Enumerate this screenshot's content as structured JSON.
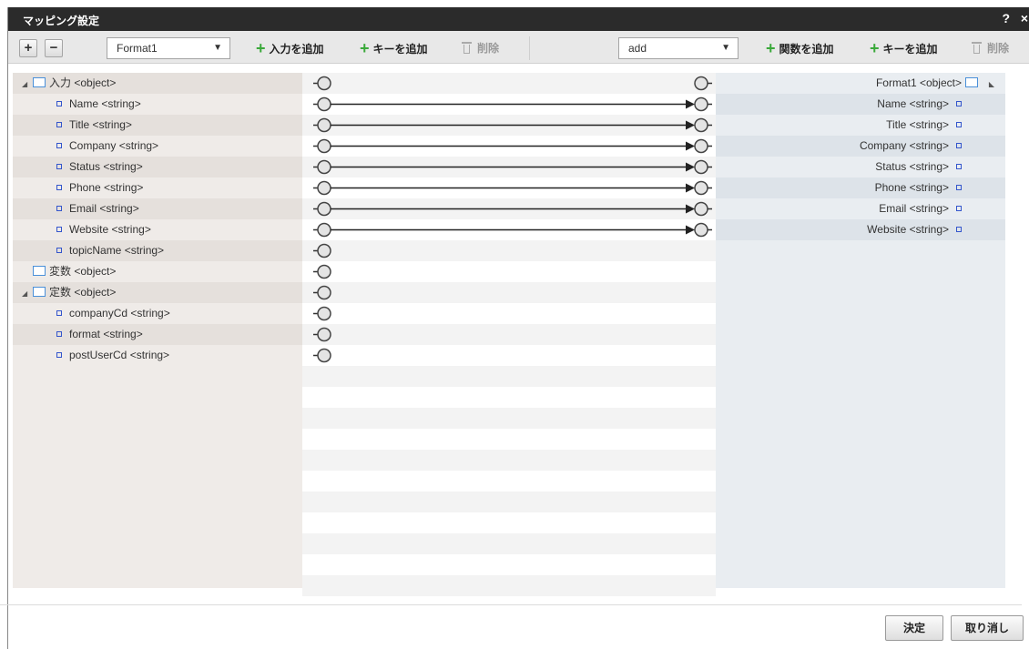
{
  "dialog": {
    "title": "マッピング設定",
    "help": "?",
    "close": "×"
  },
  "toolbar": {
    "expand": "+",
    "collapse": "−",
    "left_select": "Format1",
    "add_input": "入力を追加",
    "add_key_left": "キーを追加",
    "delete_left": "削除",
    "right_select": "add",
    "add_function": "関数を追加",
    "add_key_right": "キーを追加",
    "delete_right": "削除",
    "select_arrow": "▼"
  },
  "left_tree": [
    {
      "label": "入力 <object>",
      "kind": "object",
      "expanded": true,
      "indent": 0
    },
    {
      "label": "Name <string>",
      "kind": "string",
      "indent": 1
    },
    {
      "label": "Title <string>",
      "kind": "string",
      "indent": 1
    },
    {
      "label": "Company <string>",
      "kind": "string",
      "indent": 1
    },
    {
      "label": "Status <string>",
      "kind": "string",
      "indent": 1
    },
    {
      "label": "Phone <string>",
      "kind": "string",
      "indent": 1
    },
    {
      "label": "Email <string>",
      "kind": "string",
      "indent": 1
    },
    {
      "label": "Website <string>",
      "kind": "string",
      "indent": 1
    },
    {
      "label": "topicName <string>",
      "kind": "string",
      "indent": 1
    },
    {
      "label": "変数 <object>",
      "kind": "object",
      "expanded": false,
      "indent": 0
    },
    {
      "label": "定数 <object>",
      "kind": "object",
      "expanded": true,
      "indent": 0
    },
    {
      "label": "companyCd <string>",
      "kind": "string",
      "indent": 1
    },
    {
      "label": "format <string>",
      "kind": "string",
      "indent": 1
    },
    {
      "label": "postUserCd <string>",
      "kind": "string",
      "indent": 1
    }
  ],
  "right_tree": [
    {
      "label": "Format1 <object>",
      "kind": "object"
    },
    {
      "label": "Name <string>",
      "kind": "string"
    },
    {
      "label": "Title <string>",
      "kind": "string"
    },
    {
      "label": "Company <string>",
      "kind": "string"
    },
    {
      "label": "Status <string>",
      "kind": "string"
    },
    {
      "label": "Phone <string>",
      "kind": "string"
    },
    {
      "label": "Email <string>",
      "kind": "string"
    },
    {
      "label": "Website <string>",
      "kind": "string"
    }
  ],
  "mappings": [
    {
      "from": "Name",
      "to": "Name"
    },
    {
      "from": "Title",
      "to": "Title"
    },
    {
      "from": "Company",
      "to": "Company"
    },
    {
      "from": "Status",
      "to": "Status"
    },
    {
      "from": "Phone",
      "to": "Phone"
    },
    {
      "from": "Email",
      "to": "Email"
    },
    {
      "from": "Website",
      "to": "Website"
    }
  ],
  "footer": {
    "ok": "決定",
    "cancel": "取り消し"
  },
  "colors": {
    "titlebar": "#2b2b2b",
    "add_icon": "#3aa93a",
    "leaf_icon": "#3355cc",
    "folder_icon": "#4a90d9"
  }
}
